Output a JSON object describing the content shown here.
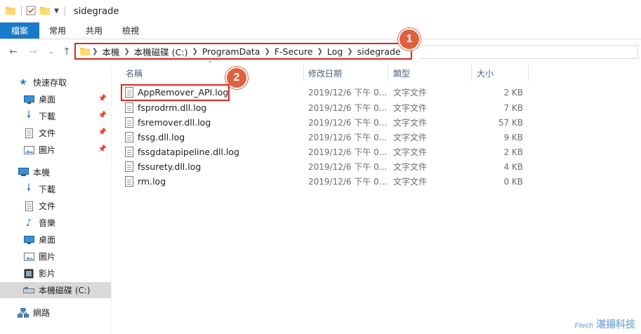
{
  "window": {
    "title": "sidegrade"
  },
  "ribbon": {
    "tabs": [
      "檔案",
      "常用",
      "共用",
      "檢視"
    ]
  },
  "address": {
    "crumbs": [
      "本機",
      "本機磁碟 (C:)",
      "ProgramData",
      "F-Secure",
      "Log",
      "sidegrade"
    ]
  },
  "badges": {
    "one": "1",
    "two": "2"
  },
  "columns": {
    "name": "名稱",
    "date": "修改日期",
    "type": "類型",
    "size": "大小"
  },
  "files": [
    {
      "name": "AppRemover_API.log",
      "date": "2019/12/6 下午 0...",
      "type": "文字文件",
      "size": "2 KB"
    },
    {
      "name": "fsprodrm.dll.log",
      "date": "2019/12/6 下午 0...",
      "type": "文字文件",
      "size": "7 KB"
    },
    {
      "name": "fsremover.dll.log",
      "date": "2019/12/6 下午 0...",
      "type": "文字文件",
      "size": "57 KB"
    },
    {
      "name": "fssg.dll.log",
      "date": "2019/12/6 下午 0...",
      "type": "文字文件",
      "size": "9 KB"
    },
    {
      "name": "fssgdatapipeline.dll.log",
      "date": "2019/12/6 下午 0...",
      "type": "文字文件",
      "size": "2 KB"
    },
    {
      "name": "fssurety.dll.log",
      "date": "2019/12/6 下午 0...",
      "type": "文字文件",
      "size": "4 KB"
    },
    {
      "name": "rm.log",
      "date": "2019/12/6 下午 0...",
      "type": "文字文件",
      "size": "0 KB"
    }
  ],
  "navpane": {
    "quick_access": "快速存取",
    "quick_items": [
      "桌面",
      "下載",
      "文件",
      "圖片"
    ],
    "this_pc": "本機",
    "pc_items": [
      "下載",
      "文件",
      "音樂",
      "桌面",
      "圖片",
      "影片",
      "本機磁碟 (C:)"
    ],
    "network": "網路"
  },
  "watermark": {
    "small": "Ftech",
    "big": "湛揚科技"
  },
  "colors": {
    "accent": "#1979ca",
    "highlight": "#e0241f",
    "badge": "#e0613f"
  }
}
